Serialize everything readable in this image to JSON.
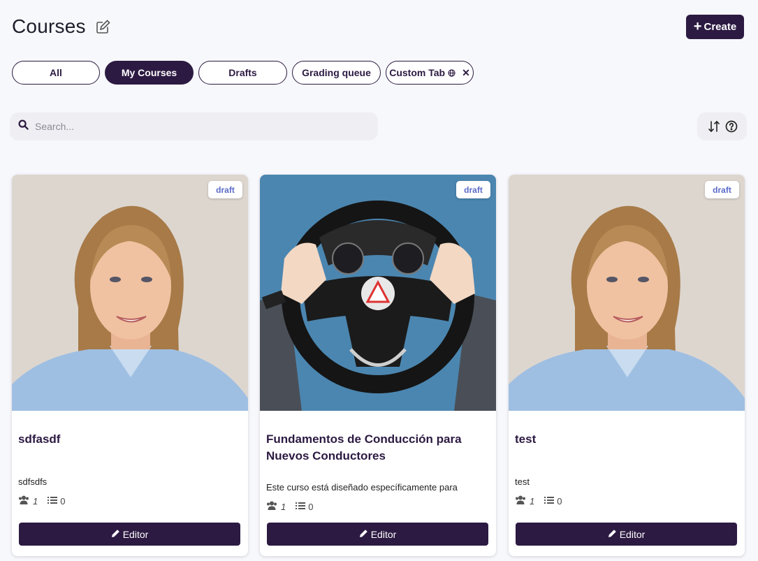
{
  "header": {
    "title": "Courses",
    "edit_icon": "edit-icon"
  },
  "toolbar": {
    "create_label": "Create",
    "create_icon": "plus-icon"
  },
  "tabs": [
    {
      "label": "All",
      "active": false
    },
    {
      "label": "My Courses",
      "active": true
    },
    {
      "label": "Drafts",
      "active": false
    },
    {
      "label": "Grading queue",
      "active": false
    },
    {
      "label": "Custom Tab",
      "active": false,
      "icons": [
        "globe-icon",
        "close-icon"
      ]
    }
  ],
  "search": {
    "placeholder": "Search...",
    "value": ""
  },
  "sort": {
    "icons": [
      "sort-icon",
      "help-icon"
    ]
  },
  "colors": {
    "primary": "#2c1a42",
    "badge_text": "#5b6bc9",
    "background": "#f7f8fb"
  },
  "courses": [
    {
      "title": "sdfasdf",
      "description": "sdfsdfs",
      "badge": "draft",
      "students": "1",
      "lessons": "0",
      "editor_label": "Editor",
      "thumbnail": "portrait-woman"
    },
    {
      "title": "Fundamentos de Conducción para Nuevos Conductores",
      "description": "Este curso está diseñado específicamente para",
      "badge": "draft",
      "students": "1",
      "lessons": "0",
      "editor_label": "Editor",
      "thumbnail": "steering-wheel"
    },
    {
      "title": "test",
      "description": "test",
      "badge": "draft",
      "students": "1",
      "lessons": "0",
      "editor_label": "Editor",
      "thumbnail": "portrait-woman"
    }
  ]
}
